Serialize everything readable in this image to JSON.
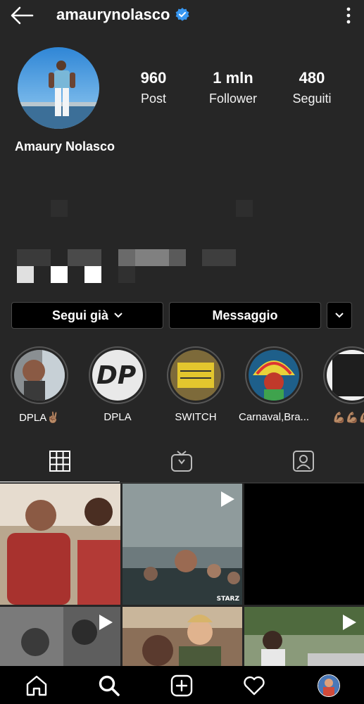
{
  "profile": {
    "username": "amaurynolasco",
    "full_name": "Amaury Nolasco",
    "stats": [
      {
        "value": "960",
        "label": "Post"
      },
      {
        "value": "1 mln",
        "label": "Follower"
      },
      {
        "value": "480",
        "label": "Seguiti"
      }
    ]
  },
  "actions": {
    "follow_label": "Segui già",
    "message_label": "Messaggio"
  },
  "highlights": [
    {
      "label": "DPLA✌🏽"
    },
    {
      "label": "DPLA"
    },
    {
      "label": "SWITCH"
    },
    {
      "label": "Carnaval,Bra..."
    },
    {
      "label": "💪🏽💪🏽💪🏽"
    }
  ],
  "grid": {
    "cells": [
      {
        "type": "photo"
      },
      {
        "type": "video",
        "caption": "STARZ"
      },
      {
        "type": "photo"
      },
      {
        "type": "video"
      },
      {
        "type": "photo"
      },
      {
        "type": "video"
      }
    ]
  },
  "colors": {
    "background": "#262626",
    "verified": "#3897f0",
    "bottom_bar": "#000000"
  }
}
